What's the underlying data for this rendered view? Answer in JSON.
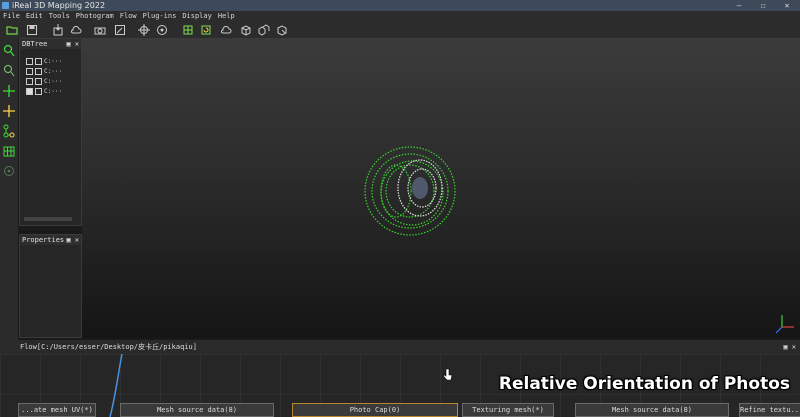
{
  "window": {
    "title": "iReal 3D Mapping 2022",
    "minimize": "—",
    "maximize": "☐",
    "close": "✕"
  },
  "menu": [
    "File",
    "Edit",
    "Tools",
    "Photogram",
    "Flow",
    "Plug-ins",
    "Display",
    "Help"
  ],
  "toolbar_icons": [
    "open-folder-icon",
    "save-icon",
    "import-icon",
    "cloud-icon",
    "camera-icon",
    "edit-icon",
    "crosshair-icon",
    "target-icon",
    "mesh-icon",
    "refresh-mesh-icon",
    "cloud-outline-icon",
    "cube-icon",
    "cube-stack-icon",
    "cube-export-icon"
  ],
  "side_toolbar_icons": [
    "zoom-icon",
    "zoom-region-icon",
    "pan-icon",
    "move-icon",
    "network-icon",
    "grid-icon",
    "rotate-icon"
  ],
  "dbtree": {
    "title": "DBTree",
    "items": [
      "C:···",
      "C:···",
      "C:···",
      "C:···"
    ]
  },
  "properties": {
    "title": "Properties"
  },
  "panel_controls": {
    "float": "▣",
    "close": "✕"
  },
  "flow": {
    "path": "Flow[C:/Users/esser/Desktop/皮卡丘/pikaqiu]"
  },
  "flow_nodes": [
    "...ate mesh UV(*)",
    "Mesh source data(8)",
    "Photo Cap(0)",
    "Texturing mesh(*)",
    "Mesh source data(8)",
    "Refine textu..."
  ],
  "caption": "Relative Orientation of Photos",
  "colors": {
    "accent_green": "#3ddc33",
    "viewport_bottom": "#151515",
    "flow_curve": "#4a90e0"
  }
}
